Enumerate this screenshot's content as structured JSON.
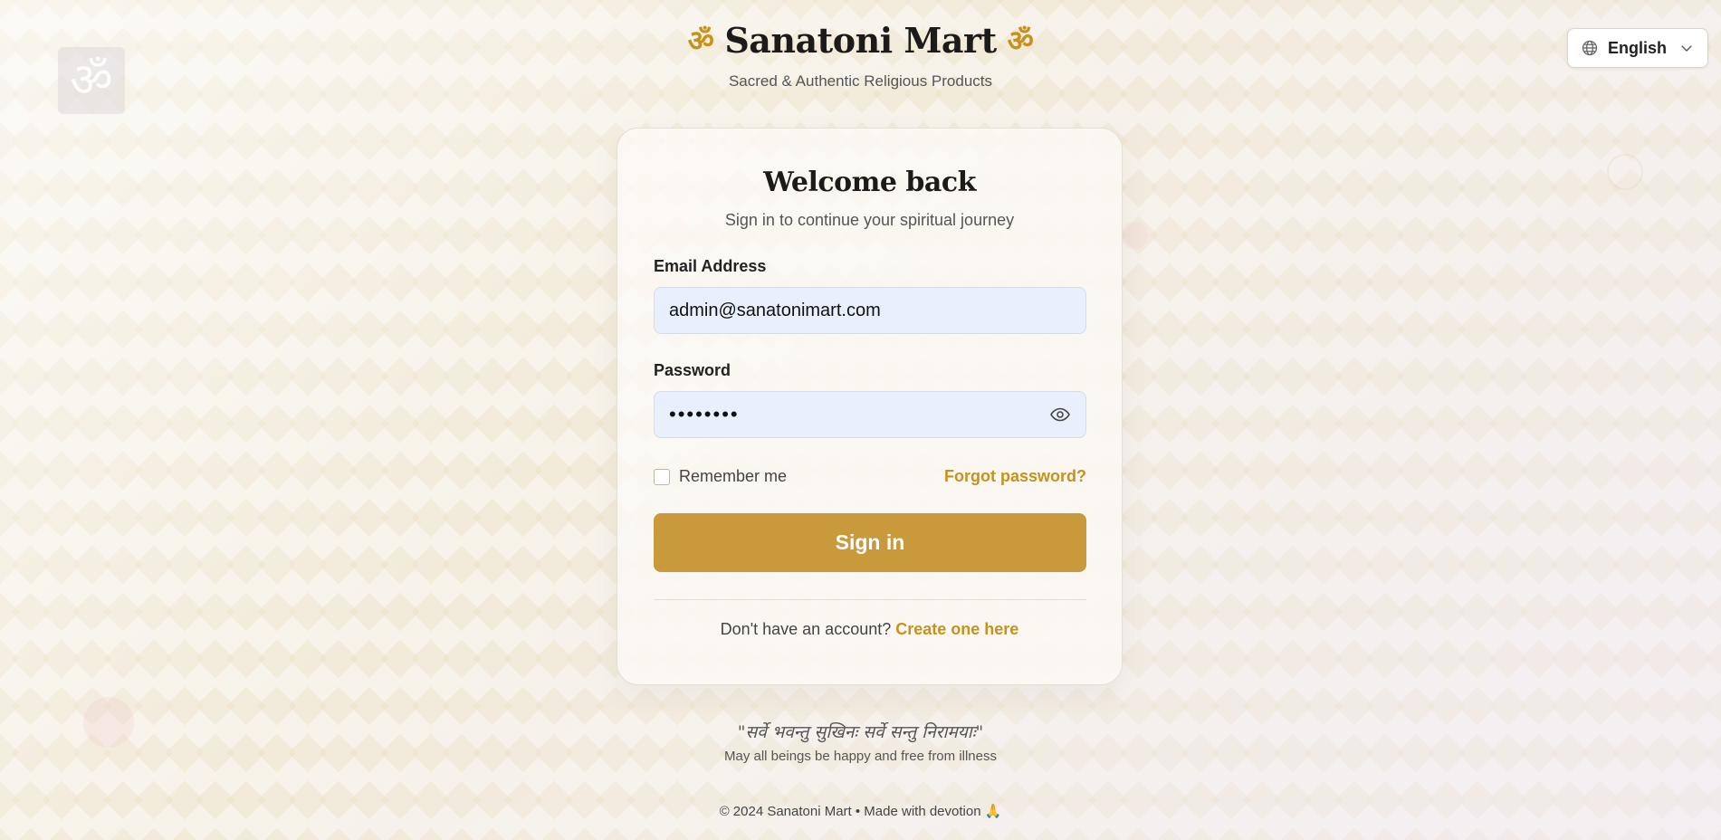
{
  "header": {
    "om_left": "ॐ",
    "brand": "Sanatoni Mart",
    "om_right": "ॐ",
    "tagline": "Sacred & Authentic Religious Products"
  },
  "language": {
    "selected": "English",
    "icon": "globe-icon",
    "chevron": "chevron-down-icon"
  },
  "decor": {
    "om": "ॐ"
  },
  "card": {
    "title": "Welcome back",
    "subtitle": "Sign in to continue your spiritual journey",
    "email_label": "Email Address",
    "email_value": "admin@sanatonimart.com",
    "password_label": "Password",
    "password_masked": "••••••••",
    "password_toggle_icon": "eye-icon",
    "remember_label": "Remember me",
    "remember_checked": false,
    "forgot_link": "Forgot password?",
    "submit_label": "Sign in",
    "signup_prompt": "Don't have an account?",
    "signup_link": "Create one here"
  },
  "quote": {
    "sanskrit": "\"सर्वे भवन्तु सुखिनः सर्वे सन्तु निरामयाः\"",
    "translation": "May all beings be happy and free from illness"
  },
  "footer": {
    "text": "© 2024 Sanatoni Mart • Made with devotion",
    "emoji": "🙏"
  },
  "colors": {
    "accent": "#c8911b",
    "button": "#c89a3c",
    "input_bg": "#e8f0fe"
  }
}
